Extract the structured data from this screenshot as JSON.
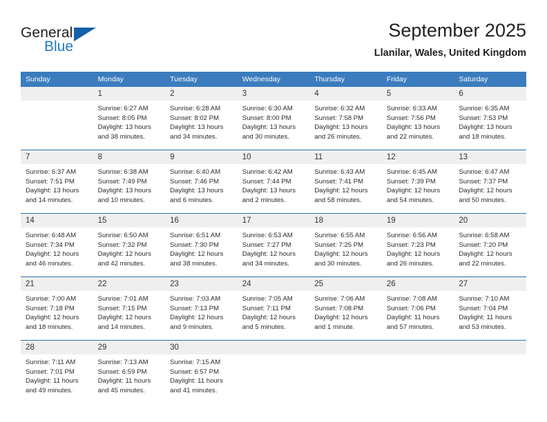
{
  "brand": {
    "name_part1": "General",
    "name_part2": "Blue",
    "flag_icon": "flag-triangle-icon",
    "accent_color": "#1560a8"
  },
  "header": {
    "title": "September 2025",
    "location": "Llanilar, Wales, United Kingdom"
  },
  "colors": {
    "header_row_bg": "#3b7cbe",
    "daynum_bg": "#efefef",
    "week_divider": "#2a6fad",
    "brand_blue": "#1f7bc4"
  },
  "weekday_headers": [
    "Sunday",
    "Monday",
    "Tuesday",
    "Wednesday",
    "Thursday",
    "Friday",
    "Saturday"
  ],
  "weeks": [
    [
      {
        "day": "",
        "sunrise": "",
        "sunset": "",
        "daylight_line1": "",
        "daylight_line2": "",
        "empty": true
      },
      {
        "day": "1",
        "sunrise": "Sunrise: 6:27 AM",
        "sunset": "Sunset: 8:05 PM",
        "daylight_line1": "Daylight: 13 hours",
        "daylight_line2": "and 38 minutes.",
        "empty": false
      },
      {
        "day": "2",
        "sunrise": "Sunrise: 6:28 AM",
        "sunset": "Sunset: 8:02 PM",
        "daylight_line1": "Daylight: 13 hours",
        "daylight_line2": "and 34 minutes.",
        "empty": false
      },
      {
        "day": "3",
        "sunrise": "Sunrise: 6:30 AM",
        "sunset": "Sunset: 8:00 PM",
        "daylight_line1": "Daylight: 13 hours",
        "daylight_line2": "and 30 minutes.",
        "empty": false
      },
      {
        "day": "4",
        "sunrise": "Sunrise: 6:32 AM",
        "sunset": "Sunset: 7:58 PM",
        "daylight_line1": "Daylight: 13 hours",
        "daylight_line2": "and 26 minutes.",
        "empty": false
      },
      {
        "day": "5",
        "sunrise": "Sunrise: 6:33 AM",
        "sunset": "Sunset: 7:56 PM",
        "daylight_line1": "Daylight: 13 hours",
        "daylight_line2": "and 22 minutes.",
        "empty": false
      },
      {
        "day": "6",
        "sunrise": "Sunrise: 6:35 AM",
        "sunset": "Sunset: 7:53 PM",
        "daylight_line1": "Daylight: 13 hours",
        "daylight_line2": "and 18 minutes.",
        "empty": false
      }
    ],
    [
      {
        "day": "7",
        "sunrise": "Sunrise: 6:37 AM",
        "sunset": "Sunset: 7:51 PM",
        "daylight_line1": "Daylight: 13 hours",
        "daylight_line2": "and 14 minutes.",
        "empty": false
      },
      {
        "day": "8",
        "sunrise": "Sunrise: 6:38 AM",
        "sunset": "Sunset: 7:49 PM",
        "daylight_line1": "Daylight: 13 hours",
        "daylight_line2": "and 10 minutes.",
        "empty": false
      },
      {
        "day": "9",
        "sunrise": "Sunrise: 6:40 AM",
        "sunset": "Sunset: 7:46 PM",
        "daylight_line1": "Daylight: 13 hours",
        "daylight_line2": "and 6 minutes.",
        "empty": false
      },
      {
        "day": "10",
        "sunrise": "Sunrise: 6:42 AM",
        "sunset": "Sunset: 7:44 PM",
        "daylight_line1": "Daylight: 13 hours",
        "daylight_line2": "and 2 minutes.",
        "empty": false
      },
      {
        "day": "11",
        "sunrise": "Sunrise: 6:43 AM",
        "sunset": "Sunset: 7:41 PM",
        "daylight_line1": "Daylight: 12 hours",
        "daylight_line2": "and 58 minutes.",
        "empty": false
      },
      {
        "day": "12",
        "sunrise": "Sunrise: 6:45 AM",
        "sunset": "Sunset: 7:39 PM",
        "daylight_line1": "Daylight: 12 hours",
        "daylight_line2": "and 54 minutes.",
        "empty": false
      },
      {
        "day": "13",
        "sunrise": "Sunrise: 6:47 AM",
        "sunset": "Sunset: 7:37 PM",
        "daylight_line1": "Daylight: 12 hours",
        "daylight_line2": "and 50 minutes.",
        "empty": false
      }
    ],
    [
      {
        "day": "14",
        "sunrise": "Sunrise: 6:48 AM",
        "sunset": "Sunset: 7:34 PM",
        "daylight_line1": "Daylight: 12 hours",
        "daylight_line2": "and 46 minutes.",
        "empty": false
      },
      {
        "day": "15",
        "sunrise": "Sunrise: 6:50 AM",
        "sunset": "Sunset: 7:32 PM",
        "daylight_line1": "Daylight: 12 hours",
        "daylight_line2": "and 42 minutes.",
        "empty": false
      },
      {
        "day": "16",
        "sunrise": "Sunrise: 6:51 AM",
        "sunset": "Sunset: 7:30 PM",
        "daylight_line1": "Daylight: 12 hours",
        "daylight_line2": "and 38 minutes.",
        "empty": false
      },
      {
        "day": "17",
        "sunrise": "Sunrise: 6:53 AM",
        "sunset": "Sunset: 7:27 PM",
        "daylight_line1": "Daylight: 12 hours",
        "daylight_line2": "and 34 minutes.",
        "empty": false
      },
      {
        "day": "18",
        "sunrise": "Sunrise: 6:55 AM",
        "sunset": "Sunset: 7:25 PM",
        "daylight_line1": "Daylight: 12 hours",
        "daylight_line2": "and 30 minutes.",
        "empty": false
      },
      {
        "day": "19",
        "sunrise": "Sunrise: 6:56 AM",
        "sunset": "Sunset: 7:23 PM",
        "daylight_line1": "Daylight: 12 hours",
        "daylight_line2": "and 26 minutes.",
        "empty": false
      },
      {
        "day": "20",
        "sunrise": "Sunrise: 6:58 AM",
        "sunset": "Sunset: 7:20 PM",
        "daylight_line1": "Daylight: 12 hours",
        "daylight_line2": "and 22 minutes.",
        "empty": false
      }
    ],
    [
      {
        "day": "21",
        "sunrise": "Sunrise: 7:00 AM",
        "sunset": "Sunset: 7:18 PM",
        "daylight_line1": "Daylight: 12 hours",
        "daylight_line2": "and 18 minutes.",
        "empty": false
      },
      {
        "day": "22",
        "sunrise": "Sunrise: 7:01 AM",
        "sunset": "Sunset: 7:15 PM",
        "daylight_line1": "Daylight: 12 hours",
        "daylight_line2": "and 14 minutes.",
        "empty": false
      },
      {
        "day": "23",
        "sunrise": "Sunrise: 7:03 AM",
        "sunset": "Sunset: 7:13 PM",
        "daylight_line1": "Daylight: 12 hours",
        "daylight_line2": "and 9 minutes.",
        "empty": false
      },
      {
        "day": "24",
        "sunrise": "Sunrise: 7:05 AM",
        "sunset": "Sunset: 7:11 PM",
        "daylight_line1": "Daylight: 12 hours",
        "daylight_line2": "and 5 minutes.",
        "empty": false
      },
      {
        "day": "25",
        "sunrise": "Sunrise: 7:06 AM",
        "sunset": "Sunset: 7:08 PM",
        "daylight_line1": "Daylight: 12 hours",
        "daylight_line2": "and 1 minute.",
        "empty": false
      },
      {
        "day": "26",
        "sunrise": "Sunrise: 7:08 AM",
        "sunset": "Sunset: 7:06 PM",
        "daylight_line1": "Daylight: 11 hours",
        "daylight_line2": "and 57 minutes.",
        "empty": false
      },
      {
        "day": "27",
        "sunrise": "Sunrise: 7:10 AM",
        "sunset": "Sunset: 7:04 PM",
        "daylight_line1": "Daylight: 11 hours",
        "daylight_line2": "and 53 minutes.",
        "empty": false
      }
    ],
    [
      {
        "day": "28",
        "sunrise": "Sunrise: 7:11 AM",
        "sunset": "Sunset: 7:01 PM",
        "daylight_line1": "Daylight: 11 hours",
        "daylight_line2": "and 49 minutes.",
        "empty": false
      },
      {
        "day": "29",
        "sunrise": "Sunrise: 7:13 AM",
        "sunset": "Sunset: 6:59 PM",
        "daylight_line1": "Daylight: 11 hours",
        "daylight_line2": "and 45 minutes.",
        "empty": false
      },
      {
        "day": "30",
        "sunrise": "Sunrise: 7:15 AM",
        "sunset": "Sunset: 6:57 PM",
        "daylight_line1": "Daylight: 11 hours",
        "daylight_line2": "and 41 minutes.",
        "empty": false
      },
      {
        "day": "",
        "sunrise": "",
        "sunset": "",
        "daylight_line1": "",
        "daylight_line2": "",
        "empty": true
      },
      {
        "day": "",
        "sunrise": "",
        "sunset": "",
        "daylight_line1": "",
        "daylight_line2": "",
        "empty": true
      },
      {
        "day": "",
        "sunrise": "",
        "sunset": "",
        "daylight_line1": "",
        "daylight_line2": "",
        "empty": true
      },
      {
        "day": "",
        "sunrise": "",
        "sunset": "",
        "daylight_line1": "",
        "daylight_line2": "",
        "empty": true
      }
    ]
  ]
}
